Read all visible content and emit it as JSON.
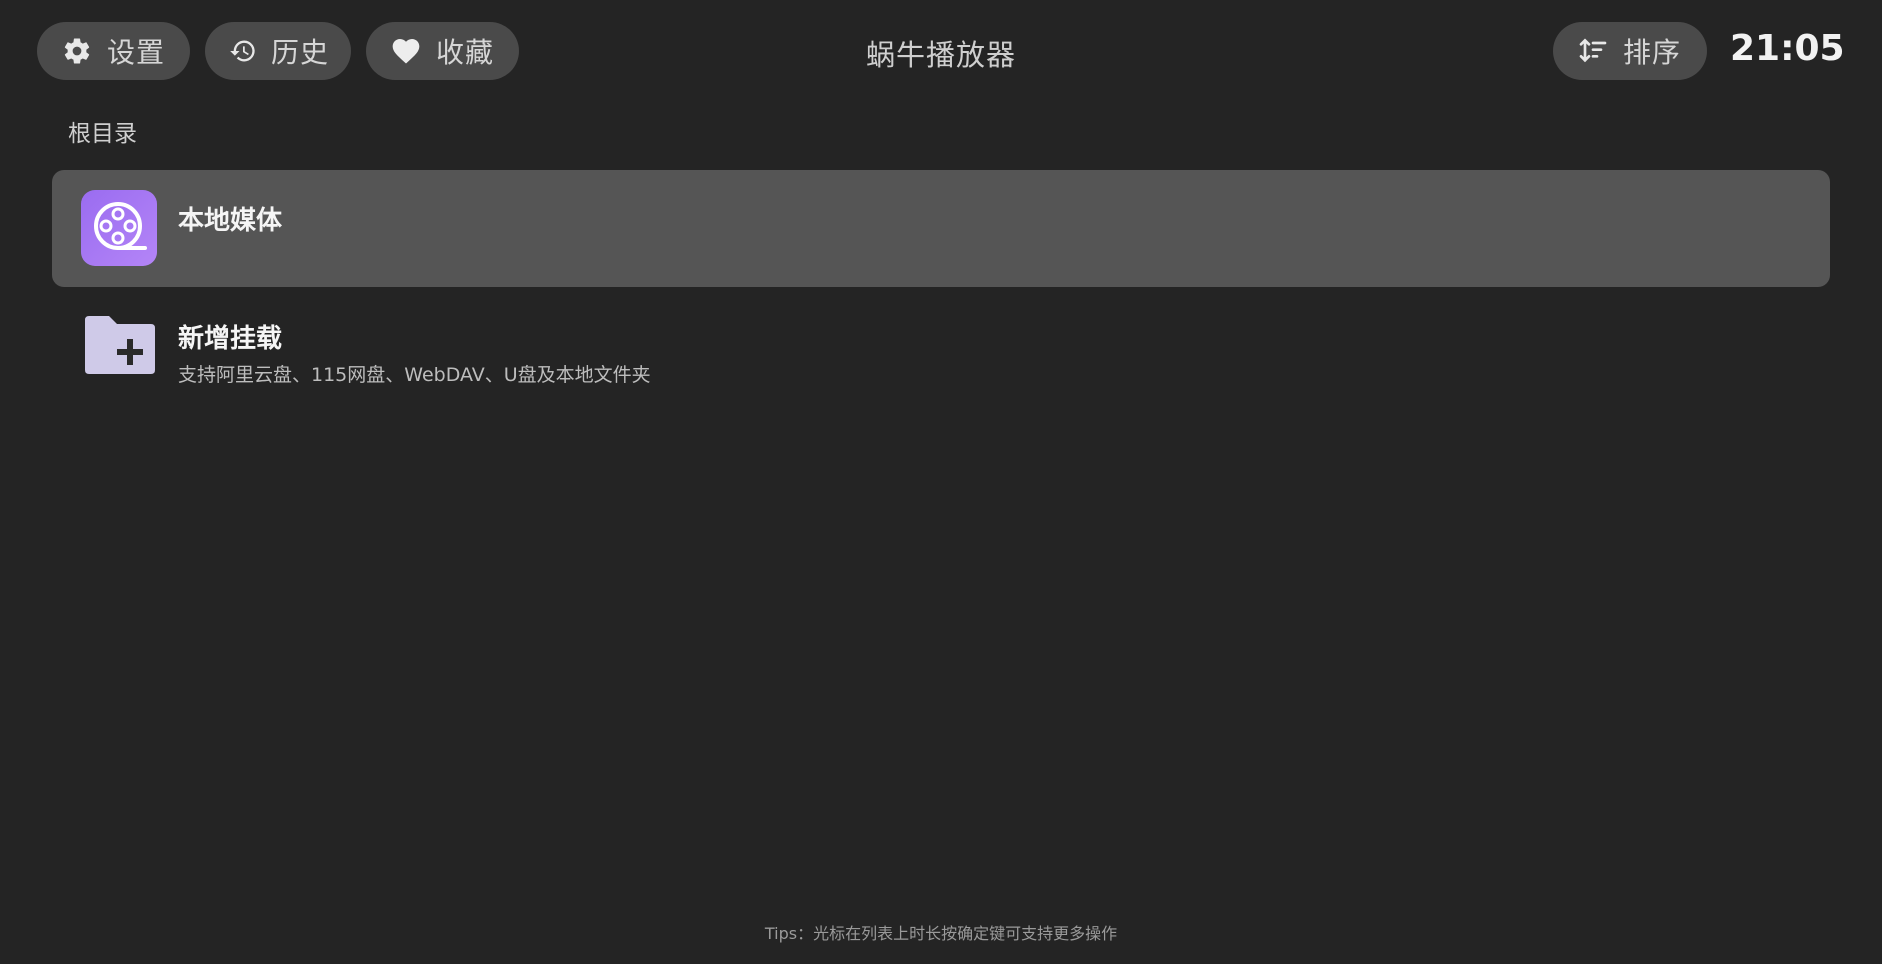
{
  "header": {
    "buttons": {
      "settings": {
        "label": "设置",
        "icon": "gear-icon"
      },
      "history": {
        "label": "历史",
        "icon": "history-icon"
      },
      "favorites": {
        "label": "收藏",
        "icon": "heart-icon"
      },
      "sort": {
        "label": "排序",
        "icon": "sort-icon"
      }
    },
    "title": "蜗牛播放器",
    "clock": "21:05"
  },
  "breadcrumb": "根目录",
  "list": {
    "items": [
      {
        "title": "本地媒体",
        "subtitle": "",
        "icon": "film-reel-icon",
        "focused": true
      },
      {
        "title": "新增挂载",
        "subtitle": "支持阿里云盘、115网盘、WebDAV、U盘及本地文件夹",
        "icon": "folder-add-icon",
        "focused": false
      }
    ]
  },
  "footer": {
    "tips": "Tips：光标在列表上时长按确定键可支持更多操作"
  },
  "colors": {
    "background": "#242424",
    "pill": "#4a4a4a",
    "focused_row": "#555555",
    "media_icon_gradient_start": "#9a6cf0",
    "media_icon_gradient_end": "#b485f7",
    "folder_icon": "#cfcae8"
  }
}
